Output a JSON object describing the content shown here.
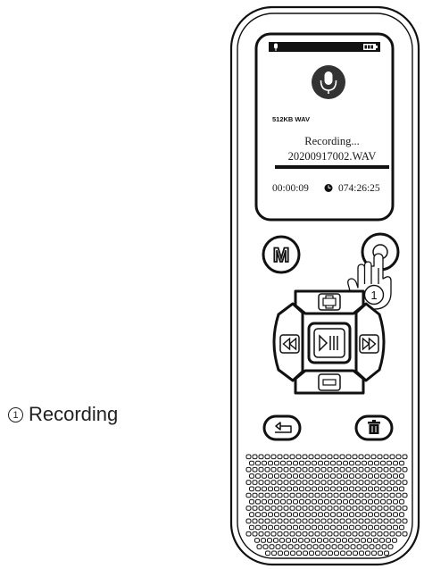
{
  "screen": {
    "quality": "512KB WAV",
    "status": "Recording...",
    "filename": "20200917002.WAV",
    "elapsed": "00:00:09",
    "remaining": "074:26:25"
  },
  "buttons": {
    "menu": "M"
  },
  "callout": {
    "marker": "1",
    "label": "Recording"
  },
  "icons": {
    "status_mic": "mic-icon",
    "battery": "battery-icon",
    "center_mic": "microphone-icon",
    "clock": "clock-icon",
    "record": "record-button-icon",
    "hand": "pointing-hand-icon",
    "volume_up": "plus-icon",
    "volume_down": "minus-icon",
    "rewind": "rewind-icon",
    "forward": "fast-forward-icon",
    "play_pause": "play-pause-icon",
    "back": "back-arrow-icon",
    "delete": "trash-icon",
    "speaker": "speaker-grille-icon"
  }
}
